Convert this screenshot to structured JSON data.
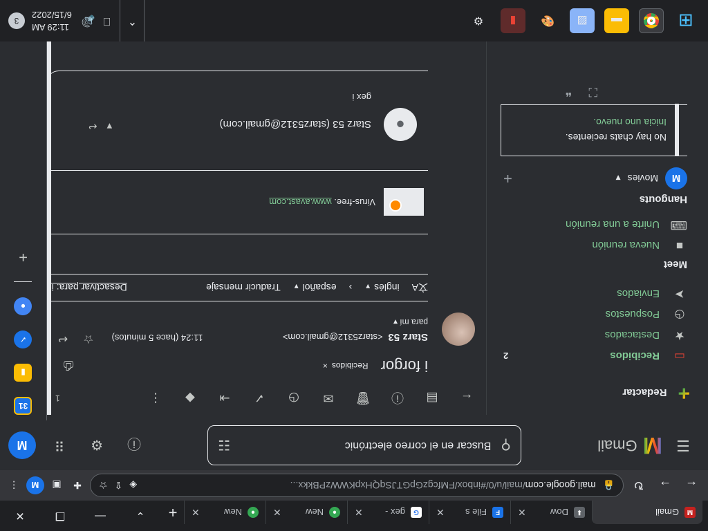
{
  "browser": {
    "tabs": [
      {
        "label": "Gmail",
        "icon": "gmail-icon",
        "active": true
      },
      {
        "label": "Dow",
        "icon": "download-icon"
      },
      {
        "label": "File s",
        "icon": "file-icon"
      },
      {
        "label": "gex -",
        "icon": "google-icon"
      },
      {
        "label": "New",
        "icon": "chrome-icon"
      },
      {
        "label": "New",
        "icon": "chrome-icon"
      }
    ],
    "url_host": "mail.google.com",
    "url_path": "/mail/u/0/#inbox/FMfcgzGpGTJSqQHxpKWWzPBkkx...",
    "profile_initial": "M"
  },
  "gmail": {
    "logo_text": "Gmail",
    "search_placeholder": "Buscar en el correo electrónic",
    "account_initial": "M"
  },
  "nav": {
    "compose": "Redactar",
    "items": [
      {
        "label": "Recibidos",
        "count": "2"
      },
      {
        "label": "Destacados"
      },
      {
        "label": "Pospuestos"
      },
      {
        "label": "Enviados"
      }
    ],
    "meet_title": "Meet",
    "meet_items": [
      "Nueva reunión",
      "Unirte a una reunión"
    ],
    "hangouts_title": "Hangouts",
    "hangouts_user": "Movies",
    "hangouts_initial": "M",
    "no_chats": "No hay chats recientes.",
    "start_new": "Inicia uno nuevo."
  },
  "message": {
    "pager": "1",
    "subject": "i forgor",
    "label": "Recibidos",
    "sender_name": "Starz 53",
    "sender_email": "<starz5312@gmail.com>",
    "time": "11:24 (hace 5 minutos)",
    "to": "para mí",
    "translate_from": "inglés",
    "translate_to": "español",
    "translate_action": "Traducir mensaje",
    "translate_off": "Desactivar para: in",
    "virus_free": "Virus-free.",
    "avast_link": "www.avast.com",
    "quoted_from": "Starz 53 (starz5312@gmail.com)",
    "quoted_text": "gex i"
  },
  "taskbar": {
    "time": "11:29 AM",
    "date": "6/15/2022",
    "notifications": "3"
  },
  "colors": {
    "background": "#2b2d31",
    "accent_green": "#81c995",
    "gmail_blue": "#1a73e8",
    "inbox_red": "#ea4335"
  }
}
